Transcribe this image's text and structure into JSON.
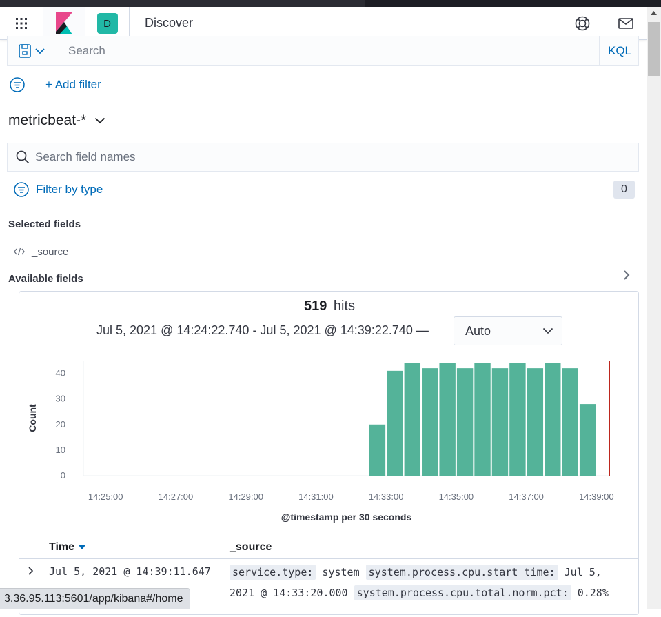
{
  "header": {
    "app_title": "Discover",
    "space_initial": "D",
    "apps_icon": "apps-grid-icon",
    "logo_icon": "kibana-logo-icon",
    "help_icon": "help-lifebuoy-icon",
    "newsfeed_icon": "mail-icon"
  },
  "querybar": {
    "placeholder": "Search",
    "language": "KQL",
    "saved_query_icon": "saved-query-icon"
  },
  "filters": {
    "add_filter_label": "+ Add filter"
  },
  "sidebar": {
    "index_pattern": "metricbeat-*",
    "field_search_placeholder": "Search field names",
    "filter_by_type_label": "Filter by type",
    "filter_count": "0",
    "selected_fields_title": "Selected fields",
    "selected_fields": [
      "_source"
    ],
    "available_fields_title": "Available fields"
  },
  "results": {
    "hits_count": "519",
    "hits_label": "hits",
    "time_range": "Jul 5, 2021 @ 14:24:22.740 - Jul 5, 2021 @ 14:39:22.740 —",
    "interval": "Auto"
  },
  "chart_data": {
    "type": "bar",
    "title": "",
    "xlabel": "@timestamp per 30 seconds",
    "ylabel": "Count",
    "ylim": [
      0,
      45
    ],
    "yticks": [
      0,
      10,
      20,
      30,
      40
    ],
    "xticks": [
      "14:25:00",
      "14:27:00",
      "14:29:00",
      "14:31:00",
      "14:33:00",
      "14:35:00",
      "14:37:00",
      "14:39:00"
    ],
    "x_range": [
      "14:24:22",
      "14:39:22"
    ],
    "categories": [
      "14:32:30",
      "14:33:00",
      "14:33:30",
      "14:34:00",
      "14:34:30",
      "14:35:00",
      "14:35:30",
      "14:36:00",
      "14:36:30",
      "14:37:00",
      "14:37:30",
      "14:38:00",
      "14:38:30",
      "14:39:00"
    ],
    "values": [
      20,
      41,
      44,
      42,
      44,
      42,
      44,
      42,
      44,
      42,
      44,
      42,
      28,
      0
    ],
    "bar_color": "#54b399",
    "now_marker": "14:39:22",
    "now_marker_color": "#bd271e",
    "grid": false
  },
  "table": {
    "col_time": "Time",
    "col_source": "_source",
    "rows": [
      {
        "time": "Jul 5, 2021 @ 14:39:11.647",
        "k1": "service.type:",
        "v1": "system",
        "k2": "system.process.cpu.start_time:",
        "v2": "Jul 5, 2021 @ 14:33:20.000",
        "k3": "system.process.cpu.total.norm.pct:",
        "v3": "0.28%"
      }
    ]
  },
  "statusbar": {
    "url": "3.36.95.113:5601/app/kibana#/home"
  }
}
